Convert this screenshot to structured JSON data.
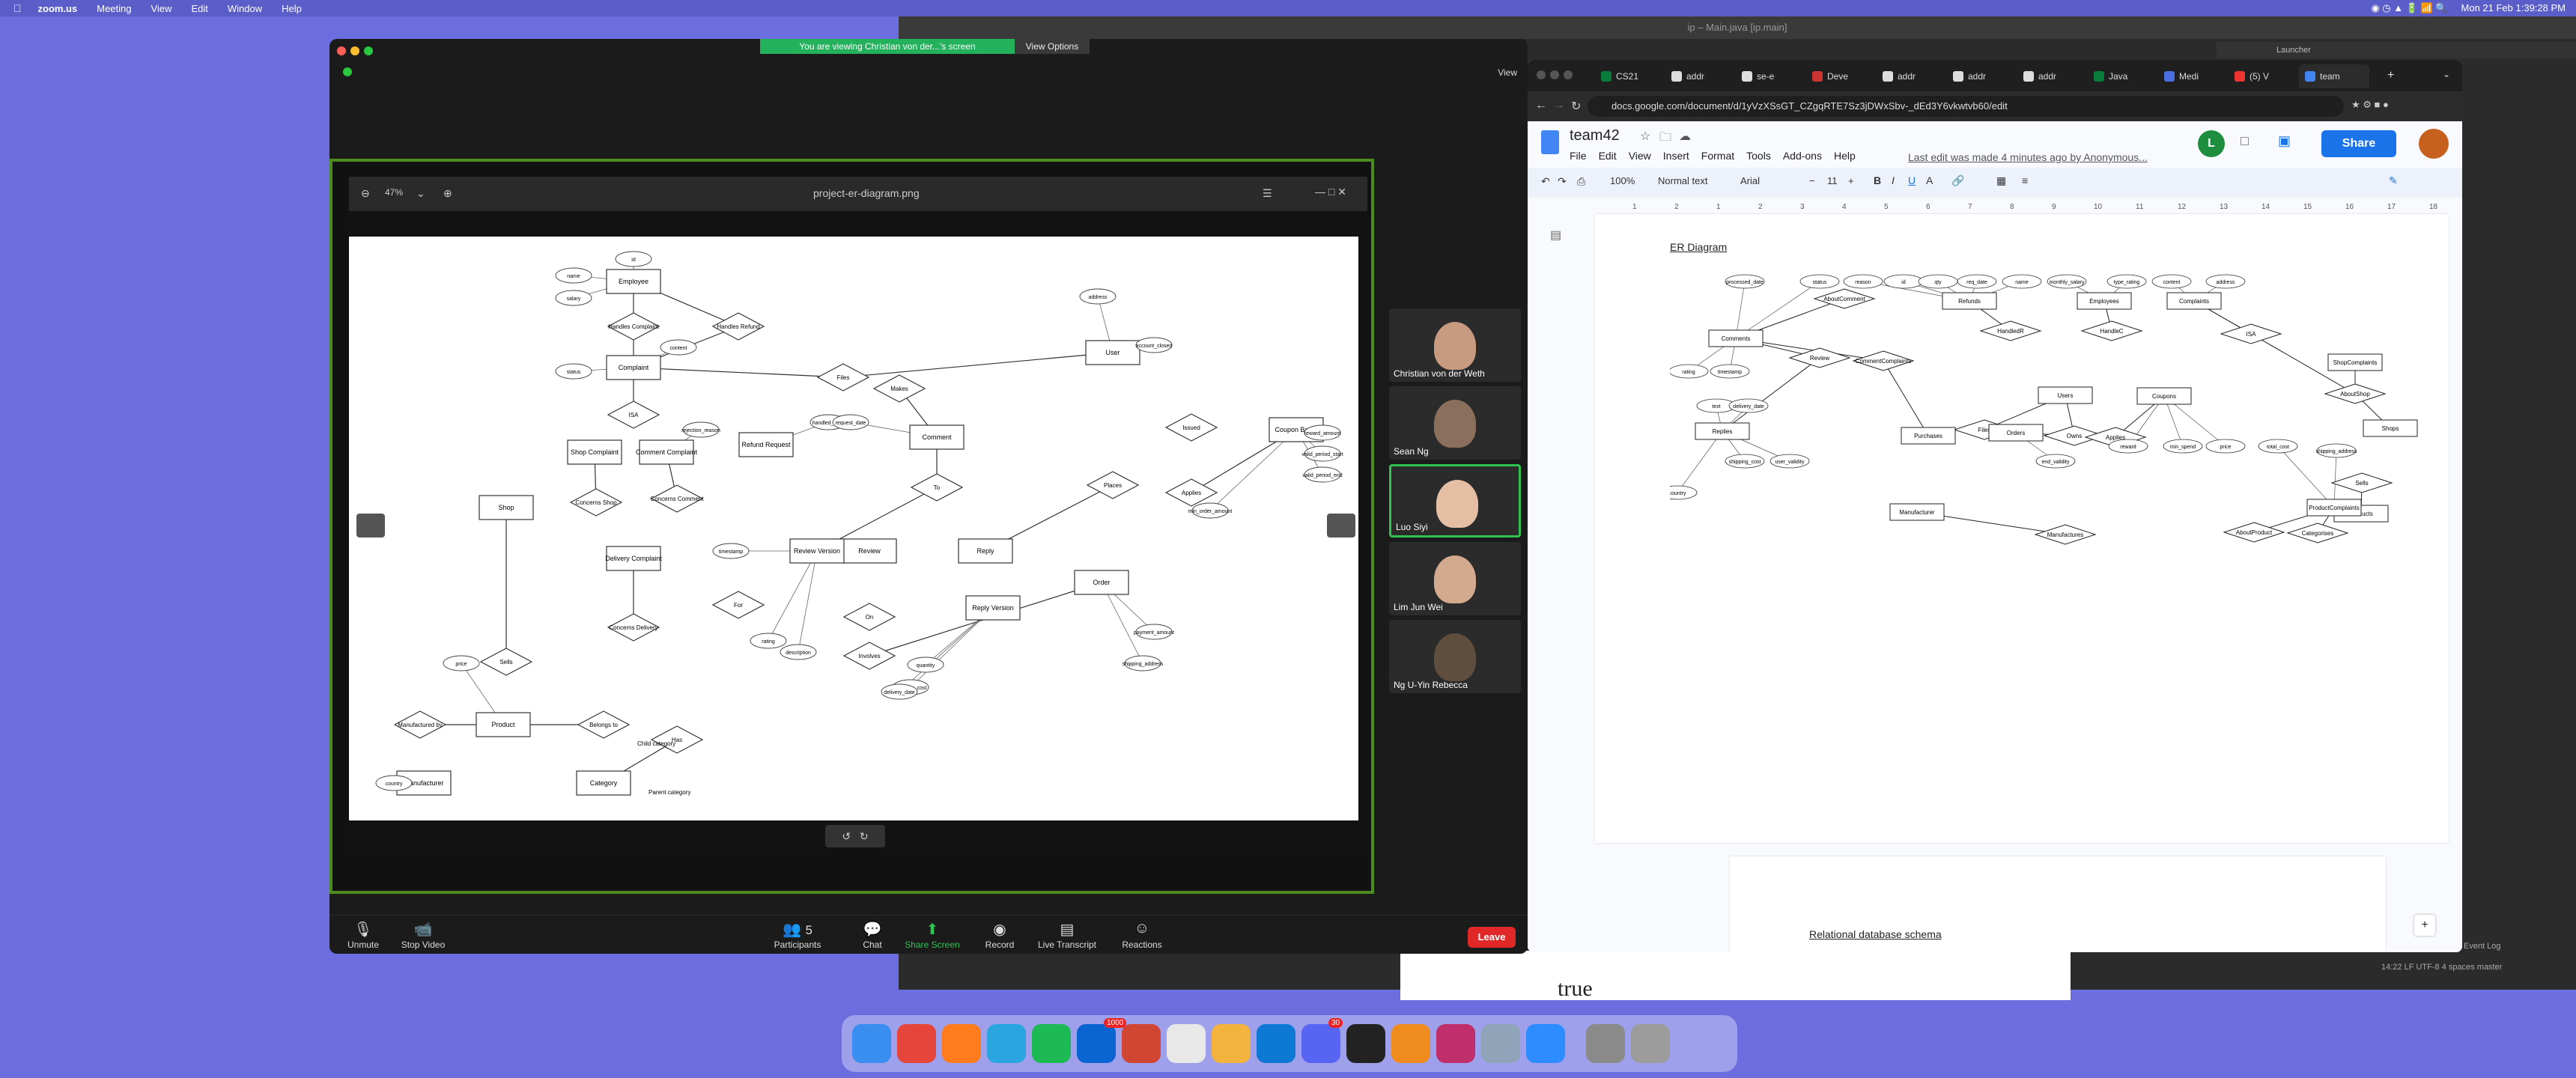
{
  "menubar": {
    "app": "zoom.us",
    "items": [
      "Meeting",
      "View",
      "Edit",
      "Window",
      "Help"
    ],
    "clock": "Mon 21 Feb  1:39:28 PM"
  },
  "zoom": {
    "banner": "You are viewing Christian von der...'s screen",
    "view_options": "View Options",
    "view_label": "View",
    "viewer": {
      "zoom": "47%",
      "filename": "project-er-diagram.png"
    },
    "participants": [
      {
        "name": "Christian von der Weth"
      },
      {
        "name": "Sean Ng"
      },
      {
        "name": "Luo Siyi"
      },
      {
        "name": "Lim Jun Wei"
      },
      {
        "name": "Ng U-Yin Rebecca"
      }
    ],
    "toolbar": {
      "unmute": "Unmute",
      "stop_video": "Stop Video",
      "participants": "Participants",
      "participants_count": "5",
      "chat": "Chat",
      "share": "Share Screen",
      "record": "Record",
      "transcript": "Live Transcript",
      "reactions": "Reactions",
      "leave": "Leave"
    }
  },
  "ide": {
    "title": "ip – Main.java [ip.main]",
    "launcher": "Launcher",
    "status": "14:22  LF  UTF-8  4 spaces  master",
    "event_log": "Event Log",
    "bottom_text": "true"
  },
  "chrome": {
    "tabs": [
      "CS21",
      "addr",
      "se-e",
      "Deve",
      "addr",
      "addr",
      "addr",
      "Java",
      "Medi",
      "(5) V",
      "team"
    ],
    "url": "docs.google.com/document/d/1yVzXSsGT_CZgqRTE7Sz3jDWxSbv-_dEd3Y6vkwtvb60/edit",
    "doc": {
      "title": "team42",
      "menu": [
        "File",
        "Edit",
        "View",
        "Insert",
        "Format",
        "Tools",
        "Add-ons",
        "Help"
      ],
      "last_edit": "Last edit was made 4 minutes ago by Anonymous...",
      "share": "Share",
      "zoom": "100%",
      "style": "Normal text",
      "font": "Arial",
      "size": "11",
      "ruler": [
        "1",
        "2",
        "1",
        "2",
        "3",
        "4",
        "5",
        "6",
        "7",
        "8",
        "9",
        "10",
        "11",
        "12",
        "13",
        "14",
        "15",
        "16",
        "17",
        "18"
      ],
      "heading1": "ER Diagram",
      "heading2": "Relational database schema"
    }
  },
  "er_left": {
    "entities": [
      "Employee",
      "Complaint",
      "Shop Complaint",
      "Comment Complaint",
      "Delivery Complaint",
      "Shop",
      "User",
      "Comment",
      "Review",
      "Reply",
      "Review Version",
      "Reply Version",
      "Order",
      "Coupon Batch",
      "Refund Request",
      "Product",
      "Category",
      "Manufacturer"
    ],
    "relations": [
      "Handles Complaint",
      "Handles Refund",
      "Files",
      "Makes",
      "ISA",
      "Concerns Shop",
      "Concerns Comment",
      "Concerns Delivery",
      "For",
      "On",
      "To",
      "Places",
      "Issued",
      "Applies",
      "Involves",
      "Sells",
      "Manufactured by",
      "Belongs to",
      "Has"
    ],
    "attributes": [
      "id",
      "name",
      "salary",
      "content",
      "status",
      "address",
      "account_closed",
      "rejection_reason",
      "handled_date",
      "request_date",
      "timestamp",
      "rating",
      "price",
      "quantity",
      "description",
      "country",
      "shipping_cost",
      "delivery_date",
      "payment_amount",
      "shipping_address",
      "min_order_amount",
      "reward_amount",
      "valid_period_start",
      "valid_period_end"
    ],
    "labels": [
      "Child category",
      "Parent category"
    ]
  },
  "er_right": {
    "entities": [
      "Comments",
      "Refunds",
      "Employees",
      "Complaints",
      "Users",
      "Coupons",
      "Purchases",
      "Manufacturer",
      "Orders",
      "Products",
      "Shops",
      "ShopComplaints",
      "ProductComplaints",
      "Categories",
      "Replies"
    ],
    "relations": [
      "AboutComment",
      "HandledR",
      "HandleC",
      "ISA",
      "Review",
      "CommentComplaints",
      "Files",
      "Owns",
      "Applies",
      "AboutShop",
      "Sells",
      "Manufactures",
      "AboutProduct",
      "Categorises",
      "Parent"
    ],
    "attributes": [
      "processed_date",
      "status",
      "reason",
      "id",
      "qty",
      "req_date",
      "name",
      "monthly_salary",
      "type_rating",
      "content",
      "address",
      "rating",
      "timestamp",
      "text",
      "delivery_date",
      "shipping_cost",
      "user_validity",
      "end_validity",
      "reward",
      "min_spend",
      "price",
      "total_cost",
      "shipping_address",
      "country"
    ]
  },
  "dock": [
    "Finder",
    "Chrome",
    "Firefox",
    "Telegram",
    "Spotify",
    "Outlook",
    "Todoist",
    "Calendar",
    "Photos",
    "Edge",
    "Discord",
    "Terminal",
    "VLC",
    "IntelliJ",
    "Preview",
    "Zoom",
    "Capture",
    "Trash"
  ],
  "dock_badges": {
    "outlook": "1000",
    "discord": "30"
  }
}
